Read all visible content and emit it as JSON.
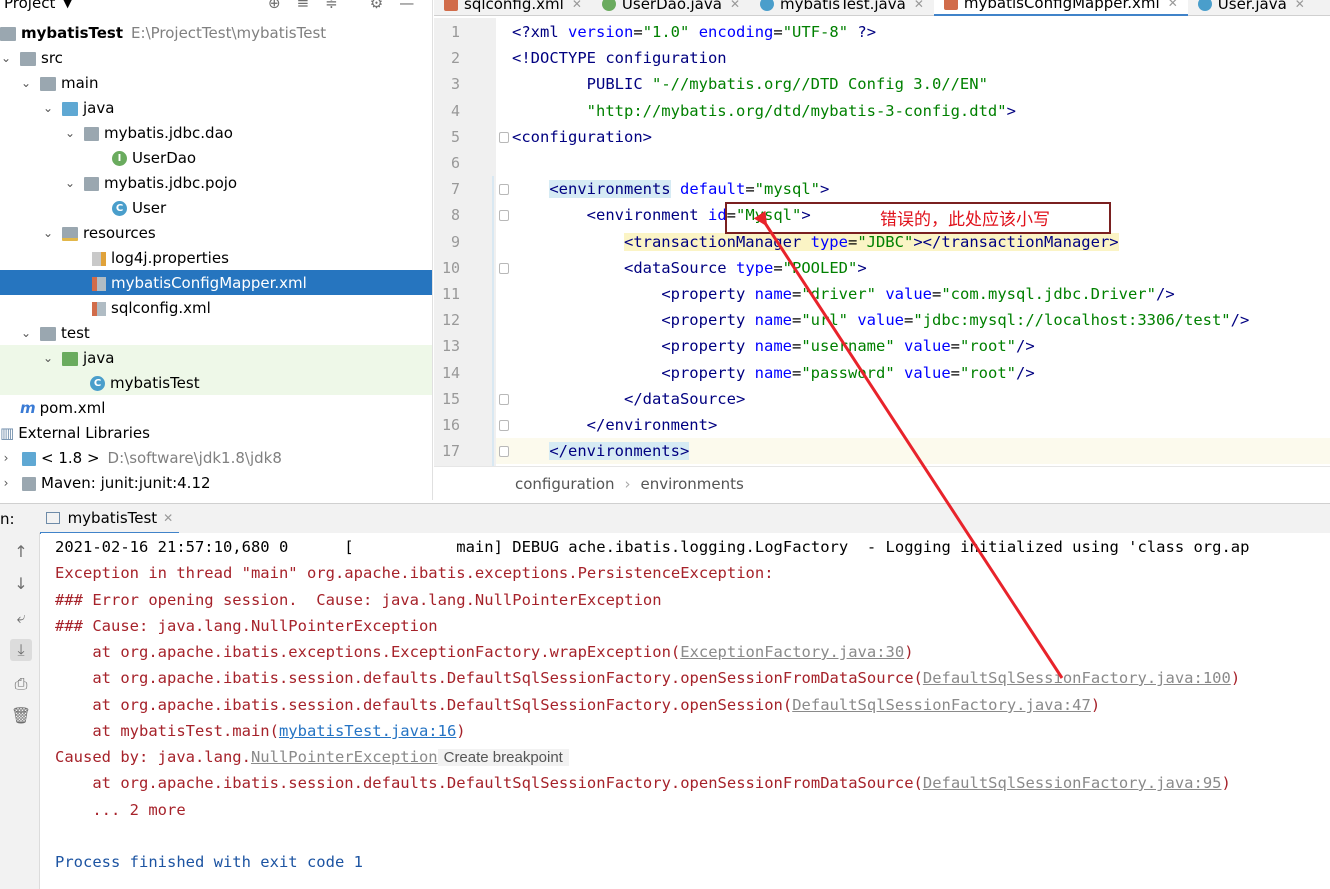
{
  "project_panel": {
    "title": "Project",
    "tree": [
      {
        "label": "mybatisTest",
        "path": "E:\\ProjectTest\\mybatisTest"
      },
      {
        "label": "src"
      },
      {
        "label": "main"
      },
      {
        "label": "java"
      },
      {
        "label": "mybatis.jdbc.dao"
      },
      {
        "label": "UserDao"
      },
      {
        "label": "mybatis.jdbc.pojo"
      },
      {
        "label": "User"
      },
      {
        "label": "resources"
      },
      {
        "label": "log4j.properties"
      },
      {
        "label": "mybatisConfigMapper.xml"
      },
      {
        "label": "sqlconfig.xml"
      },
      {
        "label": "test"
      },
      {
        "label": "java"
      },
      {
        "label": "mybatisTest"
      },
      {
        "label": "pom.xml"
      },
      {
        "label": "External Libraries"
      },
      {
        "label": "< 1.8 >",
        "path": "D:\\software\\jdk1.8\\jdk8"
      },
      {
        "label": "Maven: junit:junit:4.12"
      }
    ]
  },
  "editor_tabs": [
    {
      "label": "sqlconfig.xml"
    },
    {
      "label": "UserDao.java"
    },
    {
      "label": "mybatisTest.java"
    },
    {
      "label": "mybatisConfigMapper.xml"
    },
    {
      "label": "User.java"
    }
  ],
  "editor": {
    "line_numbers": [
      "1",
      "2",
      "3",
      "4",
      "5",
      "6",
      "7",
      "8",
      "9",
      "10",
      "11",
      "12",
      "13",
      "14",
      "15",
      "16",
      "17"
    ],
    "lines": [
      "<?xml version=\"1.0\" encoding=\"UTF-8\" ?>",
      "<!DOCTYPE configuration",
      "        PUBLIC \"-//mybatis.org//DTD Config 3.0//EN\"",
      "        \"http://mybatis.org/dtd/mybatis-3-config.dtd\">",
      "<configuration>",
      "",
      "    <environments default=\"mysql\">",
      "        <environment id=\"Mysql\">",
      "            <transactionManager type=\"JDBC\"></transactionManager>",
      "            <dataSource type=\"POOLED\">",
      "                <property name=\"driver\" value=\"com.mysql.jdbc.Driver\"/>",
      "                <property name=\"url\" value=\"jdbc:mysql://localhost:3306/test\"/>",
      "                <property name=\"username\" value=\"root\"/>",
      "                <property name=\"password\" value=\"root\"/>",
      "            </dataSource>",
      "        </environment>",
      "    </environments>"
    ]
  },
  "breadcrumb": [
    "configuration",
    "environments"
  ],
  "run_panel": {
    "label": "n:",
    "tab": "mybatisTest"
  },
  "console": {
    "line1": "2021-02-16 21:57:10,680 0      [           main] DEBUG ache.ibatis.logging.LogFactory  - Logging initialized using 'class org.ap",
    "line2": "Exception in thread \"main\" org.apache.ibatis.exceptions.PersistenceException:",
    "line3": "### Error opening session.  Cause: java.lang.NullPointerException",
    "line4": "### Cause: java.lang.NullPointerException",
    "line5_pre": "    at org.apache.ibatis.exceptions.ExceptionFactory.wrapException(",
    "line5_link": "ExceptionFactory.java:30",
    "line6_pre": "    at org.apache.ibatis.session.defaults.DefaultSqlSessionFactory.openSessionFromDataSource(",
    "line6_link": "DefaultSqlSessionFactory.java:100",
    "line7_pre": "    at org.apache.ibatis.session.defaults.DefaultSqlSessionFactory.openSession(",
    "line7_link": "DefaultSqlSessionFactory.java:47",
    "line8_pre": "    at mybatisTest.main(",
    "line8_link": "mybatisTest.java:16",
    "line9_pre": "Caused by: java.lang.",
    "line9_link": "NullPointerException",
    "line9_bp": "Create breakpoint",
    "line10_pre": "    at org.apache.ibatis.session.defaults.DefaultSqlSessionFactory.openSessionFromDataSource(",
    "line10_link": "DefaultSqlSessionFactory.java:95",
    "line11": "    ... 2 more",
    "line12": "Process finished with exit code 1",
    "close_paren": ")"
  },
  "annotation": {
    "text": "错误的，此处应该小写",
    "color": "#e0101a"
  }
}
